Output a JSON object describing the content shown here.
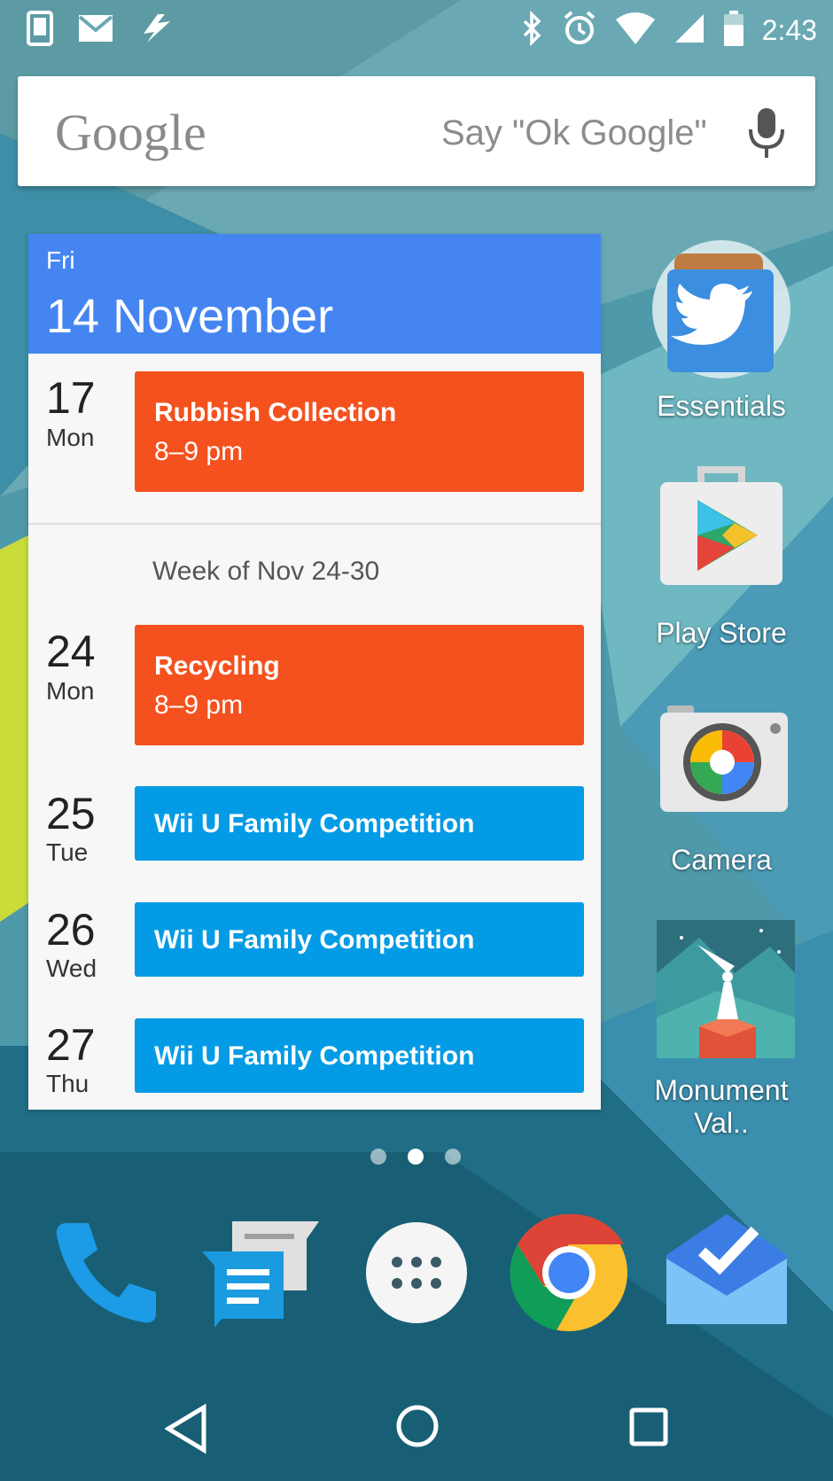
{
  "status_bar": {
    "time": "2:43",
    "left_icons": [
      "phone-notification-icon",
      "gmail-icon",
      "flash-icon"
    ],
    "right_icons": [
      "bluetooth-icon",
      "alarm-icon",
      "wifi-icon",
      "signal-icon",
      "battery-icon"
    ]
  },
  "search": {
    "logo": "Google",
    "hint": "Say \"Ok Google\""
  },
  "calendar": {
    "header_day": "Fri",
    "header_date": "14 November",
    "week_label": "Week of Nov 24-30",
    "days": [
      {
        "num": "17",
        "name": "Mon",
        "event_title": "Rubbish Collection",
        "event_time": "8–9 pm",
        "color": "#f4511e"
      },
      {
        "num": "24",
        "name": "Mon",
        "event_title": "Recycling",
        "event_time": "8–9 pm",
        "color": "#f4511e"
      },
      {
        "num": "25",
        "name": "Tue",
        "event_title": "Wii U Family Competition",
        "color": "#039be5"
      },
      {
        "num": "26",
        "name": "Wed",
        "event_title": "Wii U Family Competition",
        "color": "#039be5"
      },
      {
        "num": "27",
        "name": "Thu",
        "event_title": "Wii U Family Competition",
        "color": "#039be5"
      }
    ]
  },
  "apps": [
    {
      "label": "Essentials",
      "icon": "twitter-folder-icon"
    },
    {
      "label": "Play Store",
      "icon": "play-store-icon"
    },
    {
      "label": "Camera",
      "icon": "camera-icon"
    },
    {
      "label": "Monument Val..",
      "icon": "monument-valley-icon"
    }
  ],
  "page_indicator": {
    "count": 3,
    "active": 2
  },
  "dock": [
    "phone-icon",
    "messenger-icon",
    "app-drawer-icon",
    "chrome-icon",
    "inbox-icon"
  ],
  "nav": [
    "back-icon",
    "home-icon",
    "recents-icon"
  ]
}
